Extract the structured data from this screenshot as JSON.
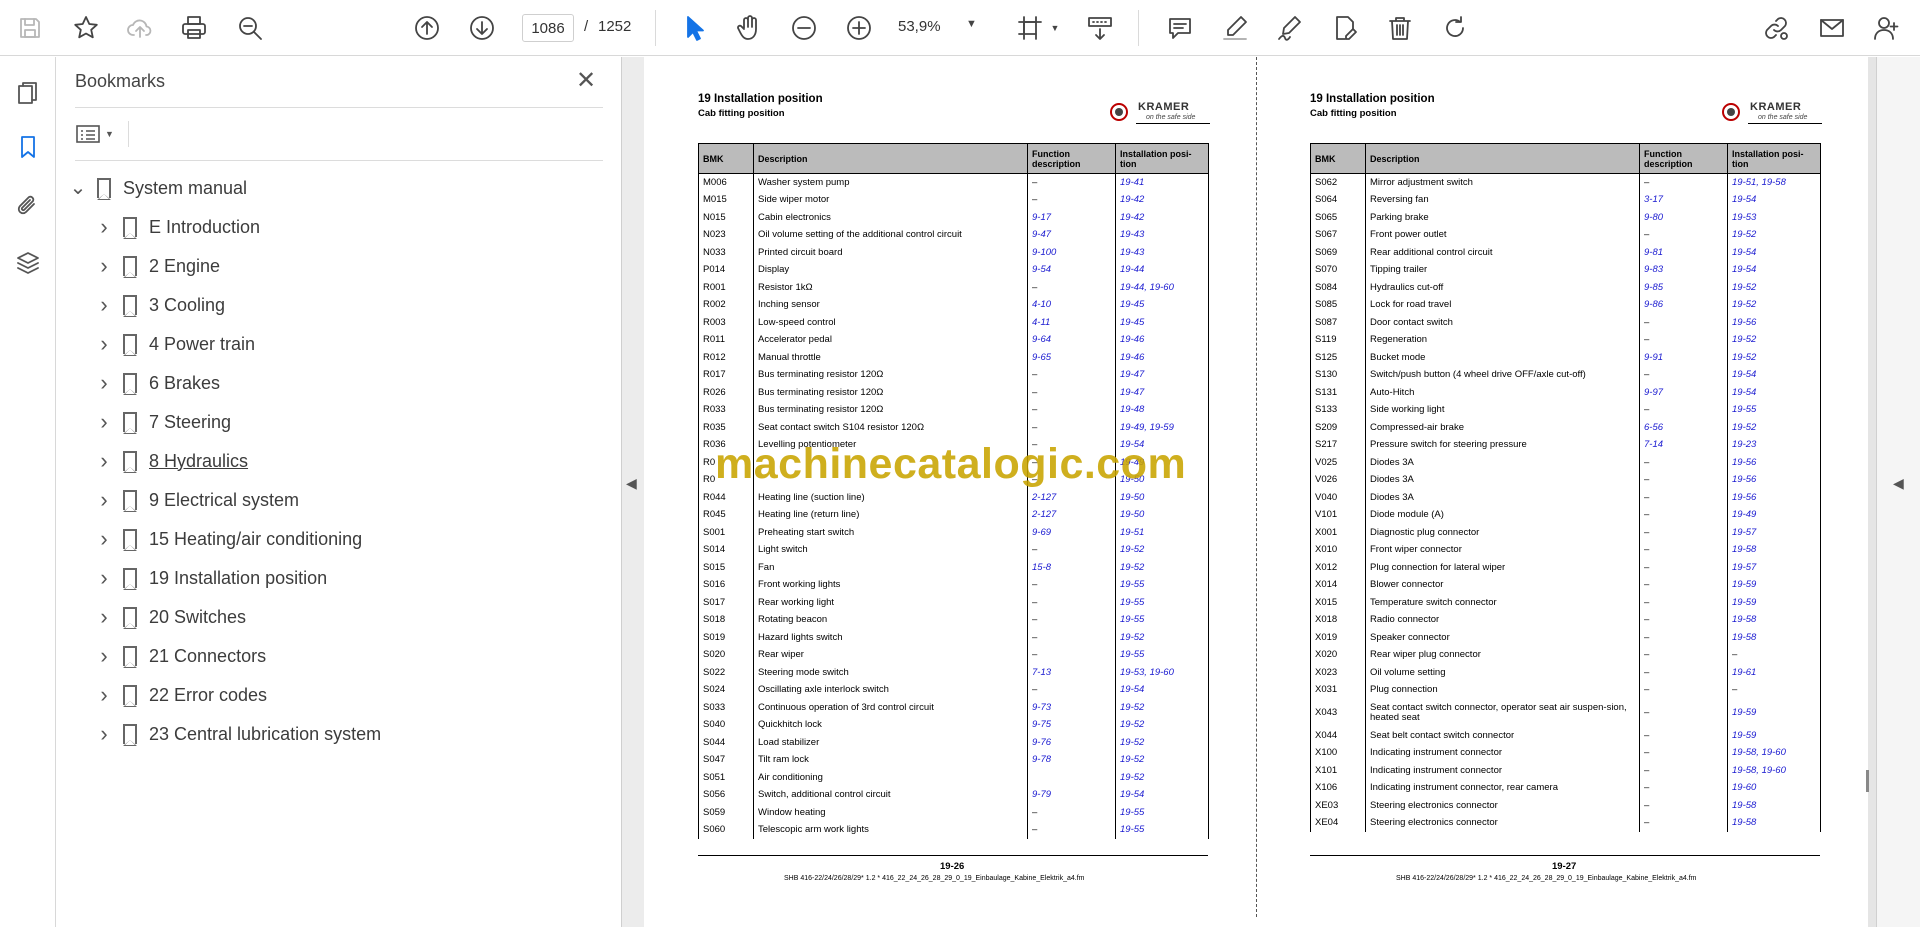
{
  "toolbar": {
    "page_current": "1086",
    "page_separator": "/",
    "page_total": "1252",
    "zoom": "53,9%"
  },
  "panel": {
    "title": "Bookmarks",
    "root": "System manual",
    "items": [
      {
        "label": "E Introduction"
      },
      {
        "label": "2 Engine"
      },
      {
        "label": "3 Cooling"
      },
      {
        "label": "4 Power train"
      },
      {
        "label": "6 Brakes"
      },
      {
        "label": "7 Steering"
      },
      {
        "label": "8 Hydraulics"
      },
      {
        "label": "9 Electrical system"
      },
      {
        "label": "15 Heating/air conditioning"
      },
      {
        "label": "19 Installation position"
      },
      {
        "label": "20 Switches"
      },
      {
        "label": "21 Connectors"
      },
      {
        "label": "22 Error codes"
      },
      {
        "label": "23 Central lubrication system"
      }
    ]
  },
  "watermark": "machinecatalogic.com",
  "pages": [
    {
      "title": "19 Installation position",
      "subtitle": "Cab fitting position",
      "logo_text": "KRAMER",
      "logo_tagline": "on the safe side",
      "headers": [
        "BMK",
        "Description",
        "Function description",
        "Installation posi-tion"
      ],
      "rows": [
        [
          "M006",
          "Washer system pump",
          "–",
          "19-41"
        ],
        [
          "M015",
          "Side wiper motor",
          "–",
          "19-42"
        ],
        [
          "N015",
          "Cabin electronics",
          "9-17",
          "19-42"
        ],
        [
          "N023",
          "Oil volume setting of the additional control circuit",
          "9-47",
          "19-43"
        ],
        [
          "N033",
          "Printed circuit board",
          "9-100",
          "19-43"
        ],
        [
          "P014",
          "Display",
          "9-54",
          "19-44"
        ],
        [
          "R001",
          "Resistor 1kΩ",
          "–",
          "19-44, 19-60"
        ],
        [
          "R002",
          "Inching sensor",
          "4-10",
          "19-45"
        ],
        [
          "R003",
          "Low-speed control",
          "4-11",
          "19-45"
        ],
        [
          "R011",
          "Accelerator pedal",
          "9-64",
          "19-46"
        ],
        [
          "R012",
          "Manual throttle",
          "9-65",
          "19-46"
        ],
        [
          "R017",
          "Bus terminating resistor 120Ω",
          "–",
          "19-47"
        ],
        [
          "R026",
          "Bus terminating resistor 120Ω",
          "–",
          "19-47"
        ],
        [
          "R033",
          "Bus terminating resistor 120Ω",
          "–",
          "19-48"
        ],
        [
          "R035",
          "Seat contact switch S104 resistor 120Ω",
          "–",
          "19-49, 19-59"
        ],
        [
          "R036",
          "Levelling potentiometer",
          "–",
          "19-54"
        ],
        [
          "R0",
          "",
          "–",
          "19-49"
        ],
        [
          "R0",
          "",
          "–",
          "19-50"
        ],
        [
          "R044",
          "Heating line (suction line)",
          "2-127",
          "19-50"
        ],
        [
          "R045",
          "Heating line (return line)",
          "2-127",
          "19-50"
        ],
        [
          "S001",
          "Preheating start switch",
          "9-69",
          "19-51"
        ],
        [
          "S014",
          "Light switch",
          "–",
          "19-52"
        ],
        [
          "S015",
          "Fan",
          "15-8",
          "19-52"
        ],
        [
          "S016",
          "Front working lights",
          "–",
          "19-55"
        ],
        [
          "S017",
          "Rear working light",
          "–",
          "19-55"
        ],
        [
          "S018",
          "Rotating beacon",
          "–",
          "19-55"
        ],
        [
          "S019",
          "Hazard lights switch",
          "–",
          "19-52"
        ],
        [
          "S020",
          "Rear wiper",
          "–",
          "19-55"
        ],
        [
          "S022",
          "Steering mode switch",
          "7-13",
          "19-53, 19-60"
        ],
        [
          "S024",
          "Oscillating axle interlock switch",
          "–",
          "19-54"
        ],
        [
          "S033",
          "Continuous operation of 3rd control circuit",
          "9-73",
          "19-52"
        ],
        [
          "S040",
          "Quickhitch lock",
          "9-75",
          "19-52"
        ],
        [
          "S044",
          "Load stabilizer",
          "9-76",
          "19-52"
        ],
        [
          "S047",
          "Tilt ram lock",
          "9-78",
          "19-52"
        ],
        [
          "S051",
          "Air conditioning",
          "",
          "19-52"
        ],
        [
          "S056",
          "Switch, additional control circuit",
          "9-79",
          "19-54"
        ],
        [
          "S059",
          "Window heating",
          "–",
          "19-55"
        ],
        [
          "S060",
          "Telescopic arm work lights",
          "–",
          "19-55"
        ]
      ],
      "page_number": "19-26",
      "footer_file": "SHB 416-22/24/26/28/29*  1.2 * 416_22_24_26_28_29_0_19_Einbaulage_Kabine_Elektrik_a4.fm"
    },
    {
      "title": "19 Installation position",
      "subtitle": "Cab fitting position",
      "logo_text": "KRAMER",
      "logo_tagline": "on the safe side",
      "headers": [
        "BMK",
        "Description",
        "Function description",
        "Installation posi-tion"
      ],
      "rows": [
        [
          "S062",
          "Mirror adjustment switch",
          "–",
          "19-51, 19-58"
        ],
        [
          "S064",
          "Reversing fan",
          "3-17",
          "19-54"
        ],
        [
          "S065",
          "Parking brake",
          "9-80",
          "19-53"
        ],
        [
          "S067",
          "Front power outlet",
          "–",
          "19-52"
        ],
        [
          "S069",
          "Rear additional control circuit",
          "9-81",
          "19-54"
        ],
        [
          "S070",
          "Tipping trailer",
          "9-83",
          "19-54"
        ],
        [
          "S084",
          "Hydraulics cut-off",
          "9-85",
          "19-52"
        ],
        [
          "S085",
          "Lock for road travel",
          "9-86",
          "19-52"
        ],
        [
          "S087",
          "Door contact switch",
          "–",
          "19-56"
        ],
        [
          "S119",
          "Regeneration",
          "–",
          "19-52"
        ],
        [
          "S125",
          "Bucket mode",
          "9-91",
          "19-52"
        ],
        [
          "S130",
          "Switch/push button (4 wheel drive OFF/axle cut-off)",
          "–",
          "19-54"
        ],
        [
          "S131",
          "Auto-Hitch",
          "9-97",
          "19-54"
        ],
        [
          "S133",
          "Side working light",
          "–",
          "19-55"
        ],
        [
          "S209",
          "Compressed-air brake",
          "6-56",
          "19-52"
        ],
        [
          "S217",
          "Pressure switch for steering pressure",
          "7-14",
          "19-23"
        ],
        [
          "V025",
          "Diodes 3A",
          "–",
          "19-56"
        ],
        [
          "V026",
          "Diodes 3A",
          "–",
          "19-56"
        ],
        [
          "V040",
          "Diodes 3A",
          "–",
          "19-56"
        ],
        [
          "V101",
          "Diode module (A)",
          "–",
          "19-49"
        ],
        [
          "X001",
          "Diagnostic plug connector",
          "–",
          "19-57"
        ],
        [
          "X010",
          "Front wiper connector",
          "–",
          "19-58"
        ],
        [
          "X012",
          "Plug connection for lateral wiper",
          "–",
          "19-57"
        ],
        [
          "X014",
          "Blower connector",
          "–",
          "19-59"
        ],
        [
          "X015",
          "Temperature switch connector",
          "–",
          "19-59"
        ],
        [
          "X018",
          "Radio connector",
          "–",
          "19-58"
        ],
        [
          "X019",
          "Speaker connector",
          "–",
          "19-58"
        ],
        [
          "X020",
          "Rear wiper plug connector",
          "–",
          "–"
        ],
        [
          "X023",
          "Oil volume setting",
          "–",
          "19-61"
        ],
        [
          "X031",
          "Plug connection",
          "–",
          "–"
        ],
        [
          "X043",
          "Seat contact switch connector, operator seat air suspen-sion, heated seat",
          "–",
          "19-59"
        ],
        [
          "X044",
          "Seat belt contact switch connector",
          "–",
          "19-59"
        ],
        [
          "X100",
          "Indicating instrument connector",
          "–",
          "19-58, 19-60"
        ],
        [
          "X101",
          "Indicating instrument connector",
          "–",
          "19-58, 19-60"
        ],
        [
          "X106",
          "Indicating instrument connector, rear camera",
          "–",
          "19-60"
        ],
        [
          "XE03",
          "Steering electronics connector",
          "–",
          "19-58"
        ],
        [
          "XE04",
          "Steering electronics connector",
          "–",
          "19-58"
        ]
      ],
      "page_number": "19-27",
      "footer_file": "SHB 416-22/24/26/28/29*  1.2 * 416_22_24_26_28_29_0_19_Einbaulage_Kabine_Elektrik_a4.fm"
    }
  ]
}
